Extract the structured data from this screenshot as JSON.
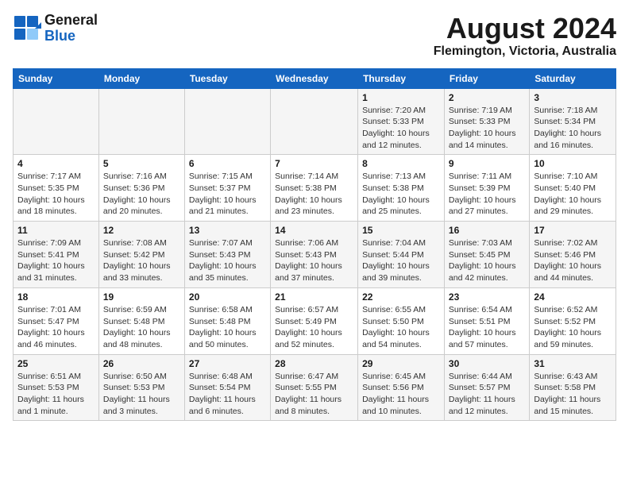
{
  "header": {
    "logo_general": "General",
    "logo_blue": "Blue",
    "title": "August 2024",
    "subtitle": "Flemington, Victoria, Australia"
  },
  "days_of_week": [
    "Sunday",
    "Monday",
    "Tuesday",
    "Wednesday",
    "Thursday",
    "Friday",
    "Saturday"
  ],
  "weeks": [
    {
      "days": [
        {
          "number": "",
          "detail": ""
        },
        {
          "number": "",
          "detail": ""
        },
        {
          "number": "",
          "detail": ""
        },
        {
          "number": "",
          "detail": ""
        },
        {
          "number": "1",
          "detail": "Sunrise: 7:20 AM\nSunset: 5:33 PM\nDaylight: 10 hours\nand 12 minutes."
        },
        {
          "number": "2",
          "detail": "Sunrise: 7:19 AM\nSunset: 5:33 PM\nDaylight: 10 hours\nand 14 minutes."
        },
        {
          "number": "3",
          "detail": "Sunrise: 7:18 AM\nSunset: 5:34 PM\nDaylight: 10 hours\nand 16 minutes."
        }
      ]
    },
    {
      "days": [
        {
          "number": "4",
          "detail": "Sunrise: 7:17 AM\nSunset: 5:35 PM\nDaylight: 10 hours\nand 18 minutes."
        },
        {
          "number": "5",
          "detail": "Sunrise: 7:16 AM\nSunset: 5:36 PM\nDaylight: 10 hours\nand 20 minutes."
        },
        {
          "number": "6",
          "detail": "Sunrise: 7:15 AM\nSunset: 5:37 PM\nDaylight: 10 hours\nand 21 minutes."
        },
        {
          "number": "7",
          "detail": "Sunrise: 7:14 AM\nSunset: 5:38 PM\nDaylight: 10 hours\nand 23 minutes."
        },
        {
          "number": "8",
          "detail": "Sunrise: 7:13 AM\nSunset: 5:38 PM\nDaylight: 10 hours\nand 25 minutes."
        },
        {
          "number": "9",
          "detail": "Sunrise: 7:11 AM\nSunset: 5:39 PM\nDaylight: 10 hours\nand 27 minutes."
        },
        {
          "number": "10",
          "detail": "Sunrise: 7:10 AM\nSunset: 5:40 PM\nDaylight: 10 hours\nand 29 minutes."
        }
      ]
    },
    {
      "days": [
        {
          "number": "11",
          "detail": "Sunrise: 7:09 AM\nSunset: 5:41 PM\nDaylight: 10 hours\nand 31 minutes."
        },
        {
          "number": "12",
          "detail": "Sunrise: 7:08 AM\nSunset: 5:42 PM\nDaylight: 10 hours\nand 33 minutes."
        },
        {
          "number": "13",
          "detail": "Sunrise: 7:07 AM\nSunset: 5:43 PM\nDaylight: 10 hours\nand 35 minutes."
        },
        {
          "number": "14",
          "detail": "Sunrise: 7:06 AM\nSunset: 5:43 PM\nDaylight: 10 hours\nand 37 minutes."
        },
        {
          "number": "15",
          "detail": "Sunrise: 7:04 AM\nSunset: 5:44 PM\nDaylight: 10 hours\nand 39 minutes."
        },
        {
          "number": "16",
          "detail": "Sunrise: 7:03 AM\nSunset: 5:45 PM\nDaylight: 10 hours\nand 42 minutes."
        },
        {
          "number": "17",
          "detail": "Sunrise: 7:02 AM\nSunset: 5:46 PM\nDaylight: 10 hours\nand 44 minutes."
        }
      ]
    },
    {
      "days": [
        {
          "number": "18",
          "detail": "Sunrise: 7:01 AM\nSunset: 5:47 PM\nDaylight: 10 hours\nand 46 minutes."
        },
        {
          "number": "19",
          "detail": "Sunrise: 6:59 AM\nSunset: 5:48 PM\nDaylight: 10 hours\nand 48 minutes."
        },
        {
          "number": "20",
          "detail": "Sunrise: 6:58 AM\nSunset: 5:48 PM\nDaylight: 10 hours\nand 50 minutes."
        },
        {
          "number": "21",
          "detail": "Sunrise: 6:57 AM\nSunset: 5:49 PM\nDaylight: 10 hours\nand 52 minutes."
        },
        {
          "number": "22",
          "detail": "Sunrise: 6:55 AM\nSunset: 5:50 PM\nDaylight: 10 hours\nand 54 minutes."
        },
        {
          "number": "23",
          "detail": "Sunrise: 6:54 AM\nSunset: 5:51 PM\nDaylight: 10 hours\nand 57 minutes."
        },
        {
          "number": "24",
          "detail": "Sunrise: 6:52 AM\nSunset: 5:52 PM\nDaylight: 10 hours\nand 59 minutes."
        }
      ]
    },
    {
      "days": [
        {
          "number": "25",
          "detail": "Sunrise: 6:51 AM\nSunset: 5:53 PM\nDaylight: 11 hours\nand 1 minute."
        },
        {
          "number": "26",
          "detail": "Sunrise: 6:50 AM\nSunset: 5:53 PM\nDaylight: 11 hours\nand 3 minutes."
        },
        {
          "number": "27",
          "detail": "Sunrise: 6:48 AM\nSunset: 5:54 PM\nDaylight: 11 hours\nand 6 minutes."
        },
        {
          "number": "28",
          "detail": "Sunrise: 6:47 AM\nSunset: 5:55 PM\nDaylight: 11 hours\nand 8 minutes."
        },
        {
          "number": "29",
          "detail": "Sunrise: 6:45 AM\nSunset: 5:56 PM\nDaylight: 11 hours\nand 10 minutes."
        },
        {
          "number": "30",
          "detail": "Sunrise: 6:44 AM\nSunset: 5:57 PM\nDaylight: 11 hours\nand 12 minutes."
        },
        {
          "number": "31",
          "detail": "Sunrise: 6:43 AM\nSunset: 5:58 PM\nDaylight: 11 hours\nand 15 minutes."
        }
      ]
    }
  ]
}
